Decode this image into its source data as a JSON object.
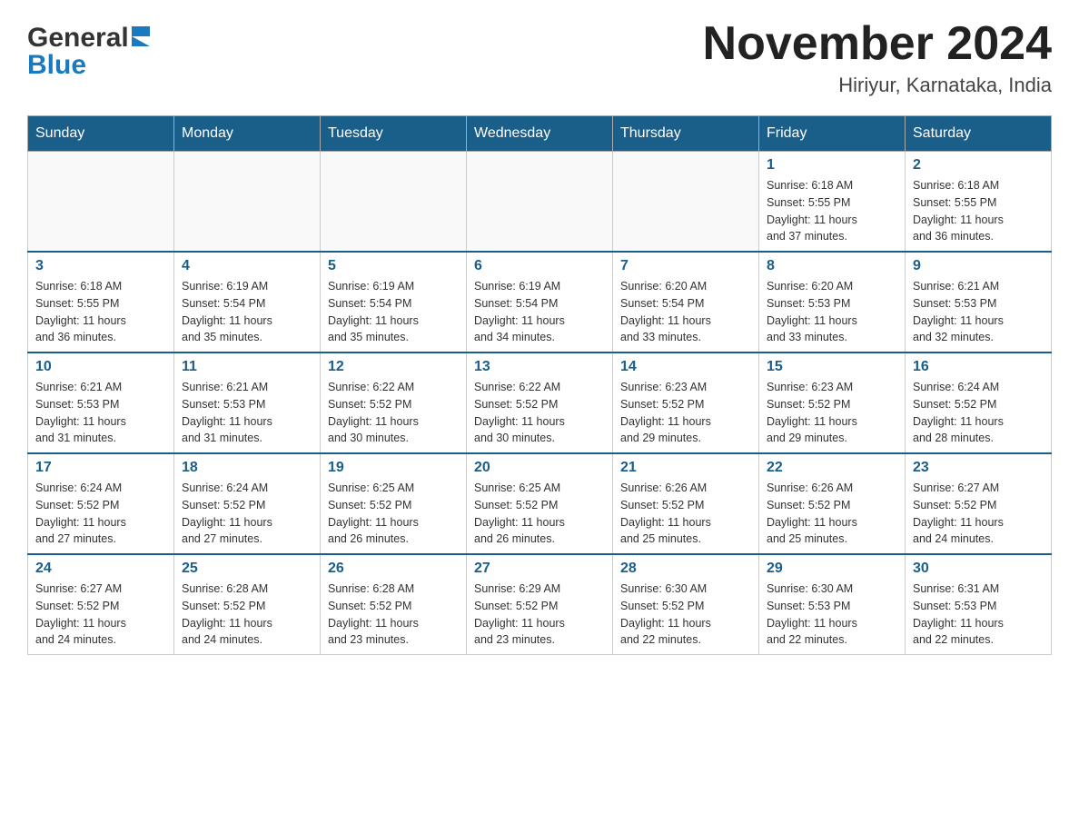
{
  "logo": {
    "general": "General",
    "blue": "Blue"
  },
  "title": "November 2024",
  "subtitle": "Hiriyur, Karnataka, India",
  "days_of_week": [
    "Sunday",
    "Monday",
    "Tuesday",
    "Wednesday",
    "Thursday",
    "Friday",
    "Saturday"
  ],
  "weeks": [
    {
      "days": [
        {
          "number": "",
          "info": ""
        },
        {
          "number": "",
          "info": ""
        },
        {
          "number": "",
          "info": ""
        },
        {
          "number": "",
          "info": ""
        },
        {
          "number": "",
          "info": ""
        },
        {
          "number": "1",
          "info": "Sunrise: 6:18 AM\nSunset: 5:55 PM\nDaylight: 11 hours\nand 37 minutes."
        },
        {
          "number": "2",
          "info": "Sunrise: 6:18 AM\nSunset: 5:55 PM\nDaylight: 11 hours\nand 36 minutes."
        }
      ]
    },
    {
      "days": [
        {
          "number": "3",
          "info": "Sunrise: 6:18 AM\nSunset: 5:55 PM\nDaylight: 11 hours\nand 36 minutes."
        },
        {
          "number": "4",
          "info": "Sunrise: 6:19 AM\nSunset: 5:54 PM\nDaylight: 11 hours\nand 35 minutes."
        },
        {
          "number": "5",
          "info": "Sunrise: 6:19 AM\nSunset: 5:54 PM\nDaylight: 11 hours\nand 35 minutes."
        },
        {
          "number": "6",
          "info": "Sunrise: 6:19 AM\nSunset: 5:54 PM\nDaylight: 11 hours\nand 34 minutes."
        },
        {
          "number": "7",
          "info": "Sunrise: 6:20 AM\nSunset: 5:54 PM\nDaylight: 11 hours\nand 33 minutes."
        },
        {
          "number": "8",
          "info": "Sunrise: 6:20 AM\nSunset: 5:53 PM\nDaylight: 11 hours\nand 33 minutes."
        },
        {
          "number": "9",
          "info": "Sunrise: 6:21 AM\nSunset: 5:53 PM\nDaylight: 11 hours\nand 32 minutes."
        }
      ]
    },
    {
      "days": [
        {
          "number": "10",
          "info": "Sunrise: 6:21 AM\nSunset: 5:53 PM\nDaylight: 11 hours\nand 31 minutes."
        },
        {
          "number": "11",
          "info": "Sunrise: 6:21 AM\nSunset: 5:53 PM\nDaylight: 11 hours\nand 31 minutes."
        },
        {
          "number": "12",
          "info": "Sunrise: 6:22 AM\nSunset: 5:52 PM\nDaylight: 11 hours\nand 30 minutes."
        },
        {
          "number": "13",
          "info": "Sunrise: 6:22 AM\nSunset: 5:52 PM\nDaylight: 11 hours\nand 30 minutes."
        },
        {
          "number": "14",
          "info": "Sunrise: 6:23 AM\nSunset: 5:52 PM\nDaylight: 11 hours\nand 29 minutes."
        },
        {
          "number": "15",
          "info": "Sunrise: 6:23 AM\nSunset: 5:52 PM\nDaylight: 11 hours\nand 29 minutes."
        },
        {
          "number": "16",
          "info": "Sunrise: 6:24 AM\nSunset: 5:52 PM\nDaylight: 11 hours\nand 28 minutes."
        }
      ]
    },
    {
      "days": [
        {
          "number": "17",
          "info": "Sunrise: 6:24 AM\nSunset: 5:52 PM\nDaylight: 11 hours\nand 27 minutes."
        },
        {
          "number": "18",
          "info": "Sunrise: 6:24 AM\nSunset: 5:52 PM\nDaylight: 11 hours\nand 27 minutes."
        },
        {
          "number": "19",
          "info": "Sunrise: 6:25 AM\nSunset: 5:52 PM\nDaylight: 11 hours\nand 26 minutes."
        },
        {
          "number": "20",
          "info": "Sunrise: 6:25 AM\nSunset: 5:52 PM\nDaylight: 11 hours\nand 26 minutes."
        },
        {
          "number": "21",
          "info": "Sunrise: 6:26 AM\nSunset: 5:52 PM\nDaylight: 11 hours\nand 25 minutes."
        },
        {
          "number": "22",
          "info": "Sunrise: 6:26 AM\nSunset: 5:52 PM\nDaylight: 11 hours\nand 25 minutes."
        },
        {
          "number": "23",
          "info": "Sunrise: 6:27 AM\nSunset: 5:52 PM\nDaylight: 11 hours\nand 24 minutes."
        }
      ]
    },
    {
      "days": [
        {
          "number": "24",
          "info": "Sunrise: 6:27 AM\nSunset: 5:52 PM\nDaylight: 11 hours\nand 24 minutes."
        },
        {
          "number": "25",
          "info": "Sunrise: 6:28 AM\nSunset: 5:52 PM\nDaylight: 11 hours\nand 24 minutes."
        },
        {
          "number": "26",
          "info": "Sunrise: 6:28 AM\nSunset: 5:52 PM\nDaylight: 11 hours\nand 23 minutes."
        },
        {
          "number": "27",
          "info": "Sunrise: 6:29 AM\nSunset: 5:52 PM\nDaylight: 11 hours\nand 23 minutes."
        },
        {
          "number": "28",
          "info": "Sunrise: 6:30 AM\nSunset: 5:52 PM\nDaylight: 11 hours\nand 22 minutes."
        },
        {
          "number": "29",
          "info": "Sunrise: 6:30 AM\nSunset: 5:53 PM\nDaylight: 11 hours\nand 22 minutes."
        },
        {
          "number": "30",
          "info": "Sunrise: 6:31 AM\nSunset: 5:53 PM\nDaylight: 11 hours\nand 22 minutes."
        }
      ]
    }
  ]
}
